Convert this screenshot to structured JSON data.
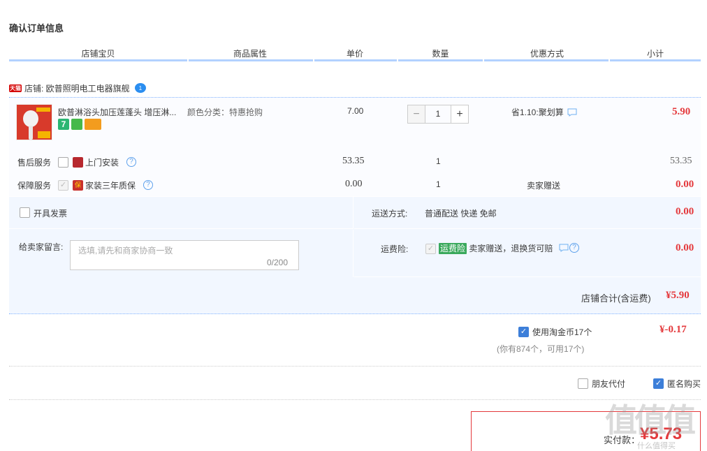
{
  "page_title": "确认订单信息",
  "columns": [
    "店铺宝贝",
    "商品属性",
    "单价",
    "数量",
    "优惠方式",
    "小计"
  ],
  "shop": {
    "tag": "天猫",
    "label": "店铺: 欧普照明电工电器旗舰",
    "chat_badge": "1"
  },
  "product": {
    "title": "欧普淋浴头加压莲蓬头 增压淋...",
    "attribute": "颜色分类：特惠抢购",
    "price": "7.00",
    "quantity": "1",
    "discount": "省1.10:聚划算",
    "subtotal": "5.90"
  },
  "services": [
    {
      "group": "售后服务",
      "name": "上门安装",
      "price": "53.35",
      "qty": "1",
      "discount": "",
      "subtotal": "53.35"
    },
    {
      "group": "保障服务",
      "name": "家装三年质保",
      "price": "0.00",
      "qty": "1",
      "discount": "卖家赠送",
      "subtotal": "0.00"
    }
  ],
  "invoice_label": "开具发票",
  "delivery": {
    "label": "运送方式:",
    "value": "普通配送 快递 免邮",
    "amount": "0.00"
  },
  "message": {
    "label": "给卖家留言:",
    "placeholder": "选填,请先和商家协商一致",
    "counter": "0/200"
  },
  "insurance": {
    "label": "运费险:",
    "tag": "运费险",
    "text": "卖家赠送，退换货可赔",
    "amount": "0.00"
  },
  "shop_total": {
    "label": "店铺合计(含运费)",
    "value": "¥5.90"
  },
  "coins": {
    "label": "使用淘金币17个",
    "sub": "(你有874个，可用17个)",
    "value": "¥-0.17"
  },
  "friend_pay": "朋友代付",
  "anonymous": "匿名购买",
  "pay": {
    "label": "实付款：",
    "value": "¥5.73"
  },
  "watermark": {
    "mark": "值值值",
    "site": "什么值得买"
  },
  "colors": {
    "accent": "#e4393c",
    "header_line": "#b2d1ff",
    "panel_bg": "#f2f7ff",
    "checkbox_on": "#3d7fd9"
  }
}
